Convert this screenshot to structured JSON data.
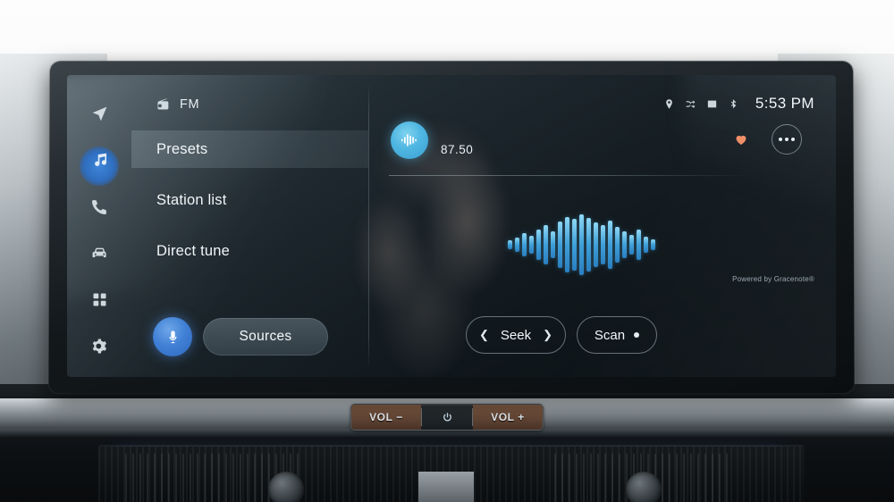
{
  "sidebar": {
    "items": [
      {
        "name": "navigation",
        "icon": "navigation-arrow-icon",
        "active": false
      },
      {
        "name": "media",
        "icon": "music-note-icon",
        "active": true
      },
      {
        "name": "phone",
        "icon": "phone-icon",
        "active": false
      },
      {
        "name": "vehicle",
        "icon": "car-icon",
        "active": false
      },
      {
        "name": "apps",
        "icon": "apps-grid-icon",
        "active": false
      },
      {
        "name": "settings",
        "icon": "gear-icon",
        "active": false
      }
    ]
  },
  "source_header": {
    "icon": "radio-icon",
    "label": "FM"
  },
  "menu": {
    "items": [
      {
        "label": "Presets",
        "selected": true
      },
      {
        "label": "Station list",
        "selected": false
      },
      {
        "label": "Direct tune",
        "selected": false
      }
    ]
  },
  "bottom_left": {
    "mic_icon": "microphone-icon",
    "sources_label": "Sources"
  },
  "status_bar": {
    "icons": [
      "location-pin-icon",
      "shuffle-icon",
      "sim-card-icon",
      "bluetooth-icon"
    ],
    "time": "5:53 PM"
  },
  "now_playing": {
    "station_icon": "radio-waveform-icon",
    "frequency": "87.50",
    "favorite_icon": "heart-icon",
    "favorite_color": "#ef8f68",
    "more_icon": "more-options-icon"
  },
  "visualizer": {
    "bars": [
      10,
      16,
      26,
      20,
      34,
      44,
      30,
      52,
      62,
      58,
      68,
      60,
      50,
      44,
      54,
      40,
      30,
      22,
      34,
      18,
      12
    ],
    "color": "#3f9fd8"
  },
  "attribution": "Powered by Gracenote®",
  "transport": {
    "seek_prev_icon": "chevron-left-icon",
    "seek_label": "Seek",
    "seek_next_icon": "chevron-right-icon",
    "scan_label": "Scan",
    "scan_indicator": "dot-icon"
  },
  "hardware_controls": {
    "volume_down_label": "VOL −",
    "power_icon": "power-button-icon",
    "volume_up_label": "VOL +"
  }
}
